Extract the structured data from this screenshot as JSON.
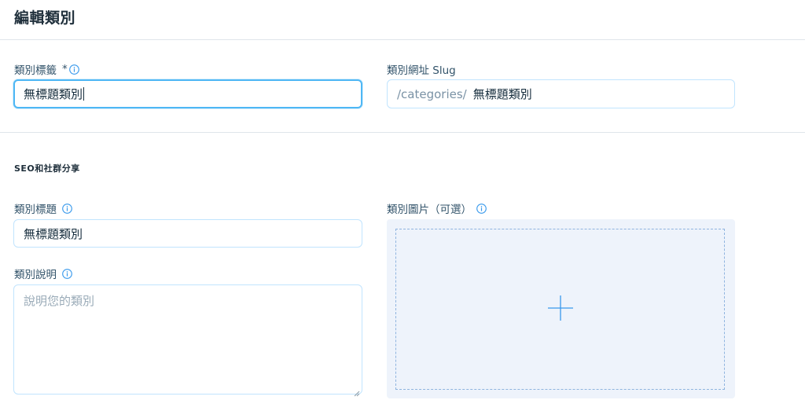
{
  "header": {
    "title": "編輯類別"
  },
  "category_label": {
    "label": "類別標籤",
    "required_mark": "*",
    "value": "無標題類別"
  },
  "category_slug": {
    "label": "類別網址 Slug",
    "prefix": "/categories/",
    "value": "無標題類別"
  },
  "seo_section": {
    "title": "SEO和社群分享",
    "category_title": {
      "label": "類別標題",
      "value": "無標題類別"
    },
    "category_description": {
      "label": "類別說明",
      "placeholder": "說明您的類別",
      "value": ""
    },
    "category_image": {
      "label": "類別圖片（可選）"
    }
  },
  "colors": {
    "input_border": "#c1e4fe",
    "focus_border": "#4eb7f5",
    "info_icon": "#3899ec",
    "image_bg": "#eef3fb",
    "image_dash": "#8fb4df"
  },
  "icons": [
    "info-icon",
    "plus-icon",
    "resize-grip-icon"
  ]
}
